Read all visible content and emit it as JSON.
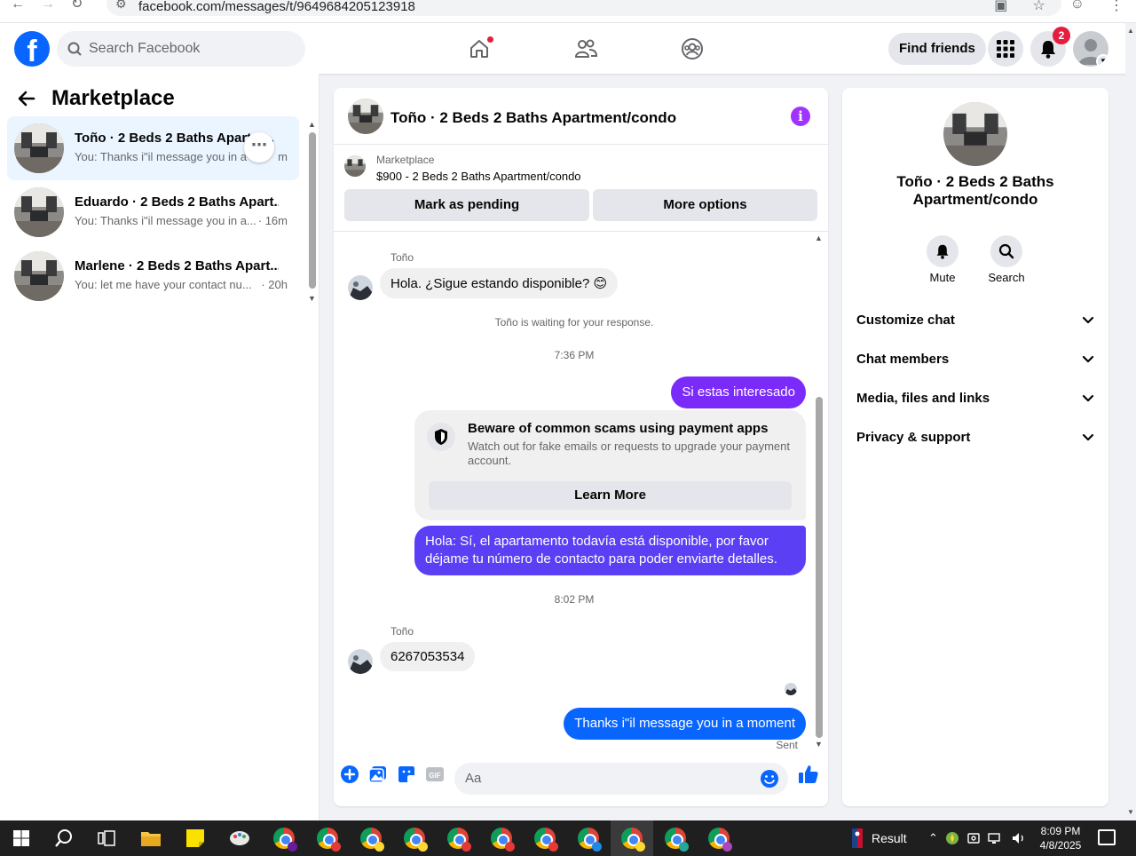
{
  "browser": {
    "url": "facebook.com/messages/t/9649684205123918"
  },
  "nav": {
    "search_placeholder": "Search Facebook",
    "find_friends": "Find friends",
    "notification_count": "2"
  },
  "left": {
    "title": "Marketplace",
    "conversations": [
      {
        "name": "Toño · 2 Beds 2 Baths Apartm...",
        "preview": "You: Thanks i\"il message you in a",
        "time": "m",
        "active": true
      },
      {
        "name": "Eduardo · 2 Beds 2 Baths Apart...",
        "preview": "You: Thanks i\"il message you in a...",
        "time": "· 16m",
        "active": false
      },
      {
        "name": "Marlene · 2 Beds 2 Baths Apart...",
        "preview": "You: let me have your contact nu...",
        "time": "· 20h",
        "active": false
      }
    ]
  },
  "chat": {
    "title": "Toño · 2 Beds 2 Baths Apartment/condo",
    "marketplace_label": "Marketplace",
    "listing": "$900 - 2 Beds 2 Baths Apartment/condo",
    "mark_pending": "Mark as pending",
    "more_options": "More options",
    "sender1": "Toño",
    "msg1": "Hola. ¿Sigue estando disponible? 😊",
    "waiting": "Toño is waiting for your response.",
    "time1": "7:36 PM",
    "out1": "Si estas interesado",
    "scam_title": "Beware of common scams using payment apps",
    "scam_body": "Watch out for fake emails or requests to upgrade your payment account.",
    "learn_more": "Learn More",
    "out2": "Hola: Sí, el apartamento todavía está disponible, por favor déjame tu número de contacto para poder enviarte detalles.",
    "time2": "8:02 PM",
    "sender2": "Toño",
    "msg2": "6267053534",
    "out3": "Thanks i\"il message you in a moment",
    "sent": "Sent",
    "composer_placeholder": "Aa"
  },
  "right": {
    "name": "Toño · 2 Beds 2 Baths Apartment/condo",
    "mute": "Mute",
    "search": "Search",
    "sections": [
      "Customize chat",
      "Chat members",
      "Media, files and links",
      "Privacy & support"
    ]
  },
  "taskbar": {
    "result": "Result",
    "time": "8:09 PM",
    "date": "4/8/2025"
  },
  "colors": {
    "fb_blue": "#0866ff",
    "purple": "#7b2bf9",
    "gradient_mid": "#5a3ff5"
  }
}
